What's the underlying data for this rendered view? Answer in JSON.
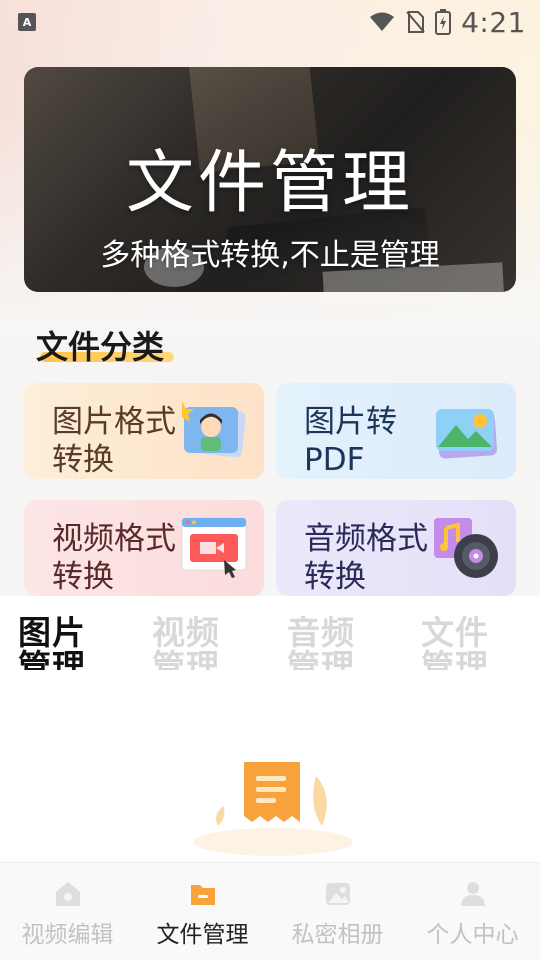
{
  "status_bar": {
    "left_badge": "A",
    "time": "4:21",
    "icons": [
      "wifi-icon",
      "no-sim-icon",
      "battery-charging-icon"
    ]
  },
  "banner": {
    "title": "文件管理",
    "subtitle": "多种格式转换,不止是管理"
  },
  "section": {
    "title": "文件分类"
  },
  "cards": [
    {
      "label": "图片格式转换",
      "icon": "image-convert-icon"
    },
    {
      "label": "图片转PDF",
      "icon": "image-to-pdf-icon"
    },
    {
      "label": "视频格式转换",
      "icon": "video-convert-icon"
    },
    {
      "label": "音频格式转换",
      "icon": "audio-convert-icon"
    }
  ],
  "tabs": [
    {
      "label": "图片管理",
      "active": true
    },
    {
      "label": "视频管理",
      "active": false
    },
    {
      "label": "音频管理",
      "active": false
    },
    {
      "label": "文件管理",
      "active": false
    }
  ],
  "empty_state": {
    "icon": "empty-document-icon"
  },
  "bottom_nav": [
    {
      "label": "视频编辑",
      "icon": "home-icon",
      "active": false
    },
    {
      "label": "文件管理",
      "icon": "folder-icon",
      "active": true
    },
    {
      "label": "私密相册",
      "icon": "album-icon",
      "active": false
    },
    {
      "label": "个人中心",
      "icon": "person-icon",
      "active": false
    }
  ],
  "colors": {
    "accent": "#f7a23b",
    "section_underline": "#ffc24a",
    "inactive": "#c2c2c2"
  }
}
